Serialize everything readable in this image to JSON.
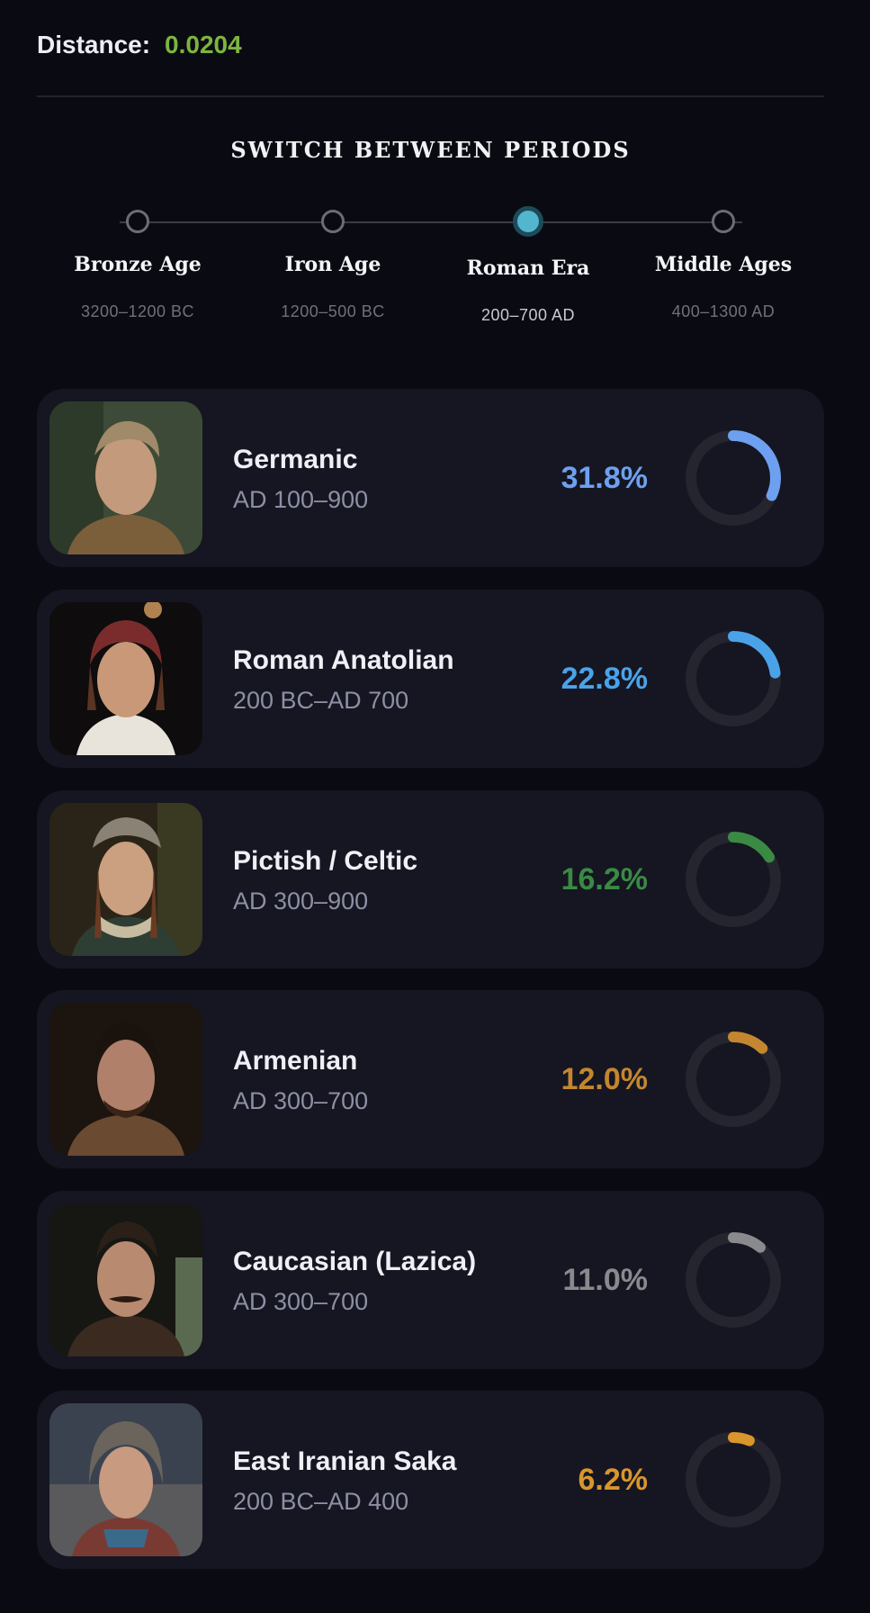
{
  "distance": {
    "label": "Distance:",
    "value": "0.0204"
  },
  "periods_title": "SWITCH BETWEEN PERIODS",
  "periods": [
    {
      "name": "Bronze Age",
      "range": "3200–1200 BC",
      "active": false
    },
    {
      "name": "Iron Age",
      "range": "1200–500 BC",
      "active": false
    },
    {
      "name": "Roman Era",
      "range": "200–700 AD",
      "active": true
    },
    {
      "name": "Middle Ages",
      "range": "400–1300 AD",
      "active": false
    }
  ],
  "populations": [
    {
      "name": "Germanic",
      "range": "AD 100–900",
      "percent_label": "31.8%",
      "percent": 31.8,
      "color": "#6ea0f0",
      "portrait": "man-blond-portrait"
    },
    {
      "name": "Roman Anatolian",
      "range": "200 BC–AD 700",
      "percent_label": "22.8%",
      "percent": 22.8,
      "color": "#4aa3e8",
      "portrait": "woman-headscarf-portrait"
    },
    {
      "name": "Pictish / Celtic",
      "range": "AD 300–900",
      "percent_label": "16.2%",
      "percent": 16.2,
      "color": "#3a8a44",
      "portrait": "woman-braids-portrait"
    },
    {
      "name": "Armenian",
      "range": "AD 300–700",
      "percent_label": "12.0%",
      "percent": 12.0,
      "color": "#c4862e",
      "portrait": "man-dark-portrait"
    },
    {
      "name": "Caucasian (Lazica)",
      "range": "AD 300–700",
      "percent_label": "11.0%",
      "percent": 11.0,
      "color": "#8a8a8e",
      "portrait": "man-mustache-portrait"
    },
    {
      "name": "East Iranian Saka",
      "range": "200 BC–AD 400",
      "percent_label": "6.2%",
      "percent": 6.2,
      "color": "#d9962c",
      "portrait": "woman-hood-portrait"
    }
  ]
}
